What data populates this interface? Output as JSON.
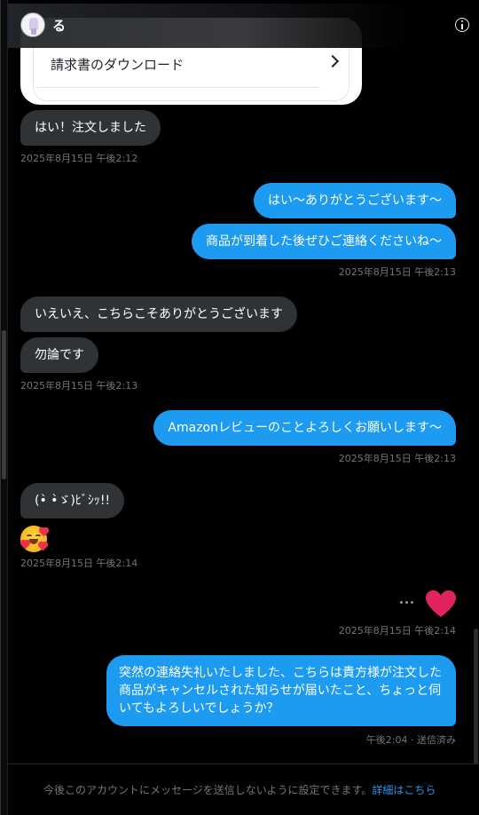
{
  "header": {
    "name": "る",
    "info_icon": "info-icon"
  },
  "invoice_card": {
    "label": "請求書のダウンロード",
    "icon": "chevron-right-icon"
  },
  "messages": [
    {
      "direction": "in",
      "text": "はい！注文しました"
    },
    {
      "ts": "2025年8月15日 午後2:12"
    },
    {
      "direction": "out",
      "text": "はい〜ありがとうございます〜"
    },
    {
      "direction": "out",
      "text": "商品が到着した後ぜひご連絡くださいね〜"
    },
    {
      "ts": "2025年8月15日 午後2:13"
    },
    {
      "direction": "in",
      "text": "いえいえ、こちらこそありがとうございます"
    },
    {
      "direction": "in",
      "text": "勿論です"
    },
    {
      "ts": "2025年8月15日 午後2:13"
    },
    {
      "direction": "out",
      "text": "Amazonレビューのことよろしくお願いします〜"
    },
    {
      "ts": "2025年8月15日 午後2:13"
    },
    {
      "direction": "in",
      "text": "(•̀ •̀ゞ)ﾋﾞｼｯ!!"
    },
    {
      "direction": "in",
      "emoji": "smiling-face-with-hearts"
    },
    {
      "ts": "2025年8月15日 午後2:14"
    },
    {
      "direction": "out",
      "emoji": "heart",
      "menu_icon": "more-icon"
    },
    {
      "ts": "2025年8月15日 午後2:14"
    },
    {
      "direction": "out",
      "lines": [
        "突然の連絡失礼いたしました、こちらは貴方様が注文した",
        "商品がキャンセルされた知らせが届いたこと、ちょっと伺",
        "いてもよろしいでしょうか？"
      ]
    },
    {
      "ts": "午後2:04 · 送信済み"
    }
  ],
  "footer": {
    "text": "今後このアカウントにメッセージを送信しないように設定できます。",
    "link": "詳細はこちら"
  },
  "colors": {
    "background": "#000000",
    "incoming_bubble": "#2f3336",
    "outgoing_bubble": "#1d9bf0",
    "timestamp": "#71767b",
    "heart": "#e0245e",
    "link": "#1d9bf0"
  }
}
